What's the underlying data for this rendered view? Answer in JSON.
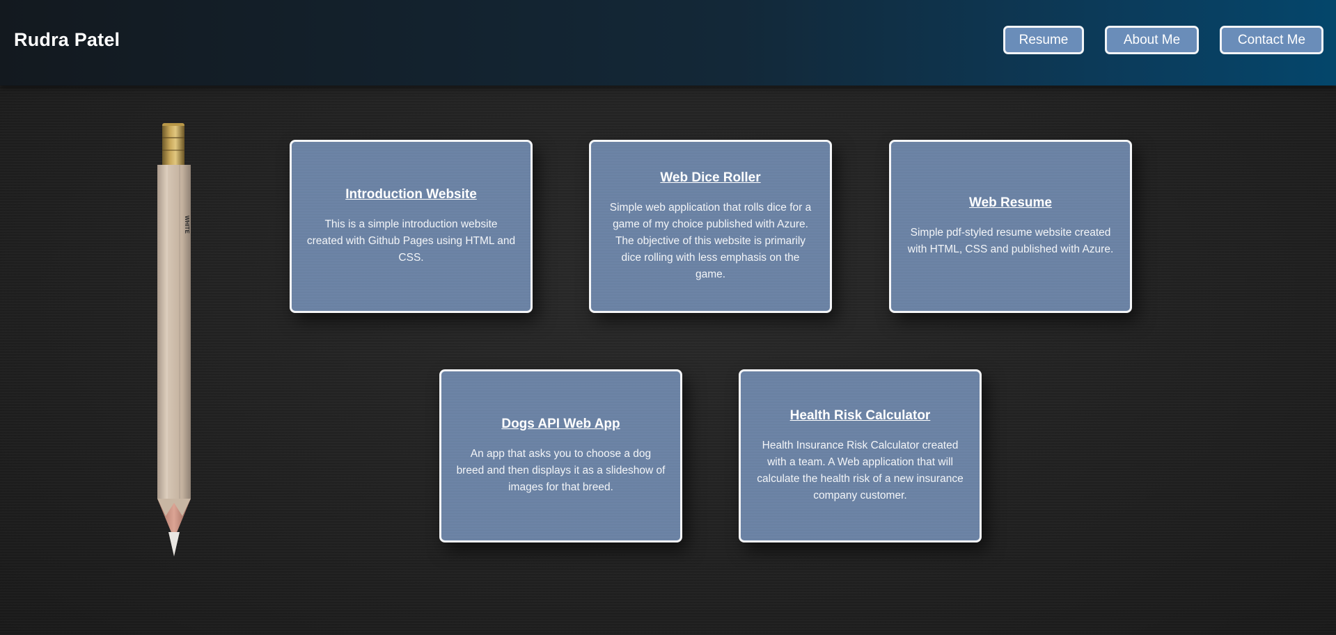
{
  "header": {
    "brand": "Rudra Patel",
    "nav": [
      {
        "label": "Resume"
      },
      {
        "label": "About Me"
      },
      {
        "label": "Contact Me"
      }
    ]
  },
  "decor": {
    "pencil_text": "WHITE"
  },
  "projects": [
    {
      "title": "Introduction Website",
      "description": "This is a simple introduction website created with Github Pages using HTML and CSS."
    },
    {
      "title": "Web Dice Roller",
      "description": "Simple web application that rolls dice for a game of my choice published with Azure. The objective of this website is primarily dice rolling with less emphasis on the game."
    },
    {
      "title": "Web Resume",
      "description": "Simple pdf-styled resume website created with HTML, CSS and published with Azure."
    },
    {
      "title": "Dogs API Web App",
      "description": "An app that asks you to choose a dog breed and then displays it as a slideshow of images for that breed."
    },
    {
      "title": "Health Risk Calculator",
      "description": "Health Insurance Risk Calculator created with a team. A Web application that will calculate the health risk of a new insurance company customer."
    }
  ],
  "colors": {
    "header_left": "#13191f",
    "header_right": "#04466b",
    "button_bg": "#6a8db9",
    "card_bg": "#6b83a5",
    "page_bg": "#232323"
  }
}
